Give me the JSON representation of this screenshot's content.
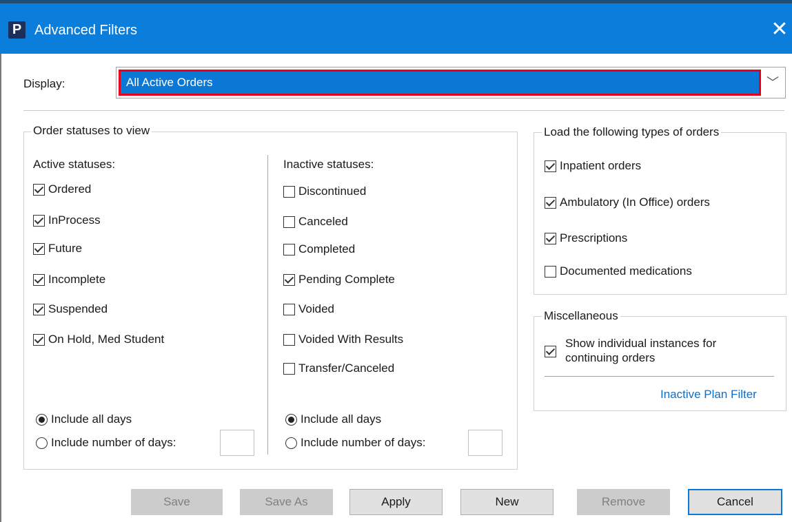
{
  "window": {
    "title": "Advanced Filters",
    "app_icon": "P",
    "close_glyph": "✕"
  },
  "display": {
    "label": "Display:",
    "value": "All Active Orders",
    "arrow_glyph": "﹀"
  },
  "order_statuses": {
    "legend": "Order statuses to view",
    "active": {
      "header": "Active statuses:",
      "items": [
        {
          "label": "Ordered",
          "checked": true
        },
        {
          "label": "InProcess",
          "checked": true
        },
        {
          "label": "Future",
          "checked": true
        },
        {
          "label": "Incomplete",
          "checked": true
        },
        {
          "label": "Suspended",
          "checked": true
        },
        {
          "label": "On Hold, Med Student",
          "checked": true
        }
      ],
      "radio_all": "Include all days",
      "radio_num": "Include number of days:",
      "selected": "all"
    },
    "inactive": {
      "header": "Inactive statuses:",
      "items": [
        {
          "label": "Discontinued",
          "checked": false
        },
        {
          "label": "Canceled",
          "checked": false
        },
        {
          "label": "Completed",
          "checked": false
        },
        {
          "label": "Pending Complete",
          "checked": true
        },
        {
          "label": "Voided",
          "checked": false
        },
        {
          "label": "Voided With Results",
          "checked": false
        },
        {
          "label": "Transfer/Canceled",
          "checked": false
        }
      ],
      "radio_all": "Include all days",
      "radio_num": "Include number of days:",
      "selected": "all"
    }
  },
  "order_types": {
    "legend": "Load the following types of orders",
    "items": [
      {
        "label": "Inpatient orders",
        "checked": true
      },
      {
        "label": "Ambulatory (In Office) orders",
        "checked": true
      },
      {
        "label": "Prescriptions",
        "checked": true
      },
      {
        "label": "Documented medications",
        "checked": false
      }
    ]
  },
  "misc": {
    "legend": "Miscellaneous",
    "show_instances_line1": "Show individual instances for",
    "show_instances_line2": "continuing orders",
    "show_instances_checked": true,
    "inactive_plan_filter": "Inactive Plan Filter"
  },
  "buttons": {
    "save": "Save",
    "save_as": "Save As",
    "apply": "Apply",
    "new": "New",
    "remove": "Remove",
    "cancel": "Cancel"
  }
}
